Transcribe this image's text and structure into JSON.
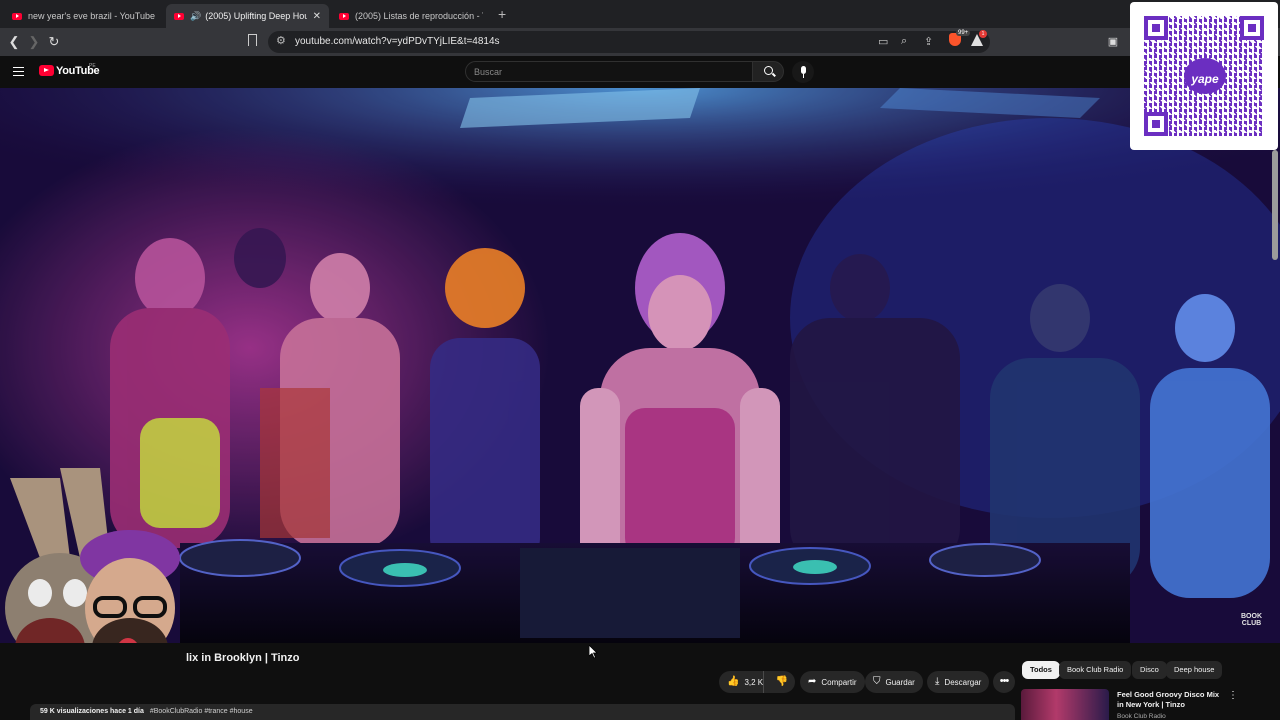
{
  "browser": {
    "tabs": [
      {
        "title": "new year's eve brazil - YouTube",
        "active": false,
        "audio": false
      },
      {
        "title": "(2005) Uplifting Deep House",
        "active": true,
        "audio": true
      },
      {
        "title": "(2005) Listas de reproducción - YouTu",
        "active": false,
        "audio": false
      }
    ],
    "url": "youtube.com/watch?v=ydPDvTYjLIE&t=4814s",
    "brave_badge": "99+",
    "rewards_badge": "1"
  },
  "youtube": {
    "logo_text": "YouTube",
    "region": "PE",
    "search_placeholder": "Buscar"
  },
  "qr": {
    "brand": "yape"
  },
  "video": {
    "channel_watermark_line1": "BOOK",
    "channel_watermark_line2": "CLUB",
    "title_visible": "lix in Brooklyn | Tinzo",
    "likes": "3,2 K",
    "share_label": "Compartir",
    "save_label": "Guardar",
    "download_label": "Descargar",
    "views_date": "59 K visualizaciones  hace 1 día",
    "hashtags": "#BookClubRadio #trance #house"
  },
  "chips": [
    "Todos",
    "Book Club Radio",
    "Disco",
    "Deep house"
  ],
  "recommendation": {
    "title": "Feel Good Groovy Disco Mix in New York | Tinzo",
    "channel": "Book Club Radio"
  },
  "colors": {
    "accent_red": "#ff0033",
    "qr_purple": "#6b2ec1",
    "bg": "#0f0f0f"
  }
}
